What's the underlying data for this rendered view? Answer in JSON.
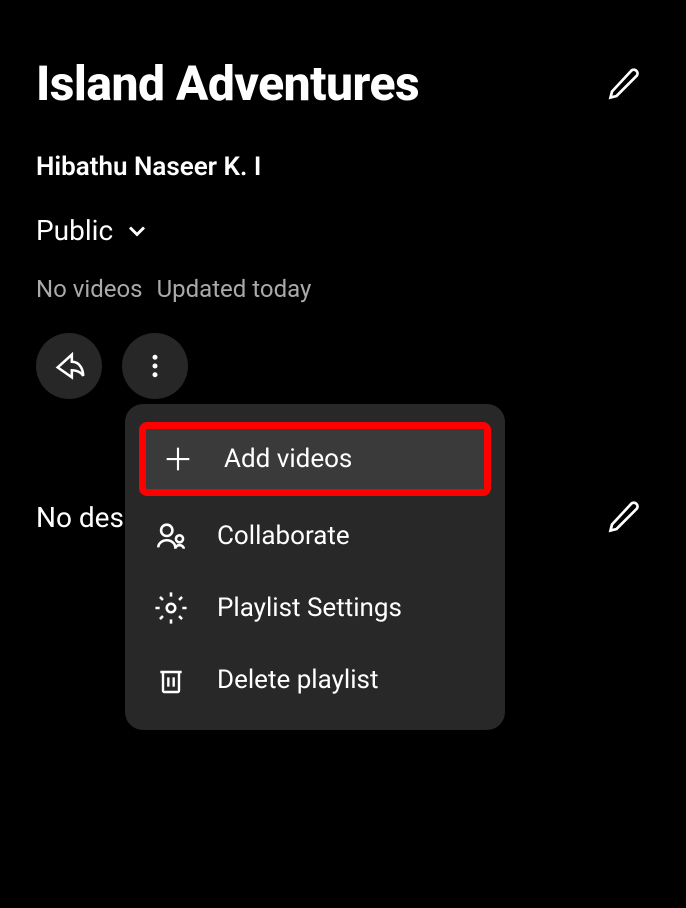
{
  "playlist": {
    "title": "Island Adventures",
    "author": "Hibathu Naseer K. I",
    "privacy": "Public",
    "video_count": "No videos",
    "updated": "Updated today",
    "description_placeholder": "No des"
  },
  "menu": {
    "add_videos": "Add videos",
    "collaborate": "Collaborate",
    "settings": "Playlist Settings",
    "delete": "Delete playlist"
  }
}
